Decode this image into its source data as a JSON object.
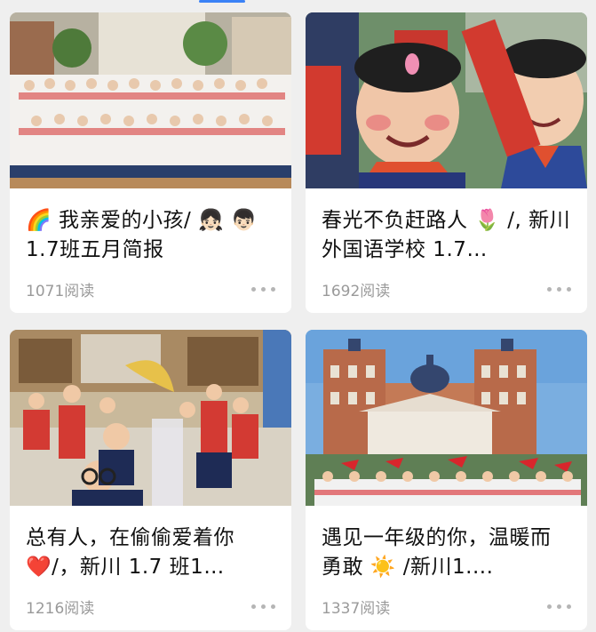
{
  "feed": {
    "cards": [
      {
        "title": "🌈 我亲爱的小孩/ 👧🏻 👦🏻1.7班五月简报",
        "reads": "1071阅读",
        "image": "group-photo-students-outdoors"
      },
      {
        "title": "春光不负赶路人 🌷 /, 新川外国语学校 1.7…",
        "reads": "1692阅读",
        "image": "smiling-child-closeup"
      },
      {
        "title": "总有人，在偷偷爱着你 ❤️/，新川 1.7 班1…",
        "reads": "1216阅读",
        "image": "classroom-children"
      },
      {
        "title": "遇见一年级的你，温暖而勇敢 ☀️ /新川1....",
        "reads": "1337阅读",
        "image": "school-building-flags"
      }
    ]
  }
}
